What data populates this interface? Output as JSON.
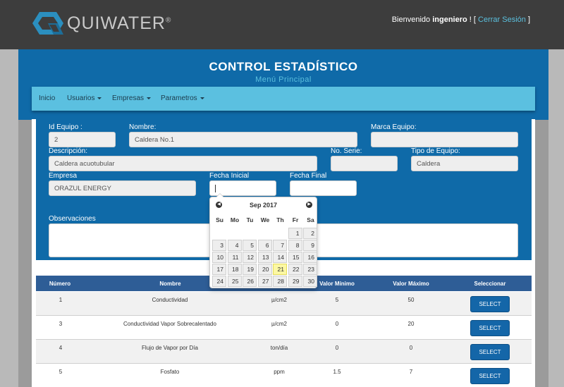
{
  "header": {
    "logo_text": "QUIWATER",
    "welcome_prefix": "Bienvenido",
    "username": "ingeniero",
    "welcome_suffix": "! [",
    "logout_label": "Cerrar Sesión",
    "close_bracket": "]"
  },
  "page": {
    "title": "CONTROL ESTADÍSTICO",
    "subtitle": "Menú Principal"
  },
  "nav": {
    "items": [
      {
        "label": "Inicio",
        "dropdown": false
      },
      {
        "label": "Usuarios",
        "dropdown": true
      },
      {
        "label": "Empresas",
        "dropdown": true
      },
      {
        "label": "Parametros",
        "dropdown": true
      }
    ]
  },
  "form": {
    "id_equipo": {
      "label": "Id Equipo :",
      "value": "2"
    },
    "nombre": {
      "label": "Nombre:",
      "value": "Caldera No.1"
    },
    "marca": {
      "label": "Marca Equipo:",
      "value": ""
    },
    "descripcion": {
      "label": "Descripción:",
      "value": "Caldera acuotubular"
    },
    "serie": {
      "label": "No. Serie:",
      "value": ""
    },
    "tipo": {
      "label": "Tipo de Equipo:",
      "value": "Caldera"
    },
    "empresa": {
      "label": "Empresa",
      "value": "ORAZUL ENERGY"
    },
    "fecha_inicial": {
      "label": "Fecha Inicial",
      "value": ""
    },
    "fecha_final": {
      "label": "Fecha Final",
      "value": ""
    },
    "observaciones": {
      "label": "Observaciones",
      "value": ""
    }
  },
  "datepicker": {
    "month_label": "Sep 2017",
    "prev_icon": "chevron-left-icon",
    "next_icon": "chevron-right-icon",
    "weekdays": [
      "Su",
      "Mo",
      "Tu",
      "We",
      "Th",
      "Fr",
      "Sa"
    ],
    "weeks": [
      [
        "",
        "",
        "",
        "",
        "",
        "1",
        "2"
      ],
      [
        "3",
        "4",
        "5",
        "6",
        "7",
        "8",
        "9"
      ],
      [
        "10",
        "11",
        "12",
        "13",
        "14",
        "15",
        "16"
      ],
      [
        "17",
        "18",
        "19",
        "20",
        "21",
        "22",
        "23"
      ],
      [
        "24",
        "25",
        "26",
        "27",
        "28",
        "29",
        "30"
      ]
    ],
    "today": "21",
    "today_color": "#fcf8a3"
  },
  "table": {
    "headers": [
      "Número",
      "Nombre",
      "",
      "Valor Mínimo",
      "Valor Máximo",
      "Seleccionar"
    ],
    "rows": [
      {
        "numero": "1",
        "nombre": "Conductividad",
        "unidad": "µ/cm2",
        "min": "5",
        "max": "50",
        "action": "SELECT"
      },
      {
        "numero": "3",
        "nombre": "Conductividad Vapor Sobrecalentado",
        "unidad": "µ/cm2",
        "min": "0",
        "max": "20",
        "action": "SELECT"
      },
      {
        "numero": "4",
        "nombre": "Flujo de Vapor por Día",
        "unidad": "ton/día",
        "min": "0",
        "max": "0",
        "action": "SELECT"
      },
      {
        "numero": "5",
        "nombre": "Fosfato",
        "unidad": "ppm",
        "min": "1.5",
        "max": "7",
        "action": "SELECT"
      }
    ]
  },
  "colors": {
    "primary": "#0f6aa8",
    "nav": "#5bc0e0",
    "table_header": "#2e5d96",
    "button": "#1466a8",
    "topbar": "#3d3d3d"
  }
}
